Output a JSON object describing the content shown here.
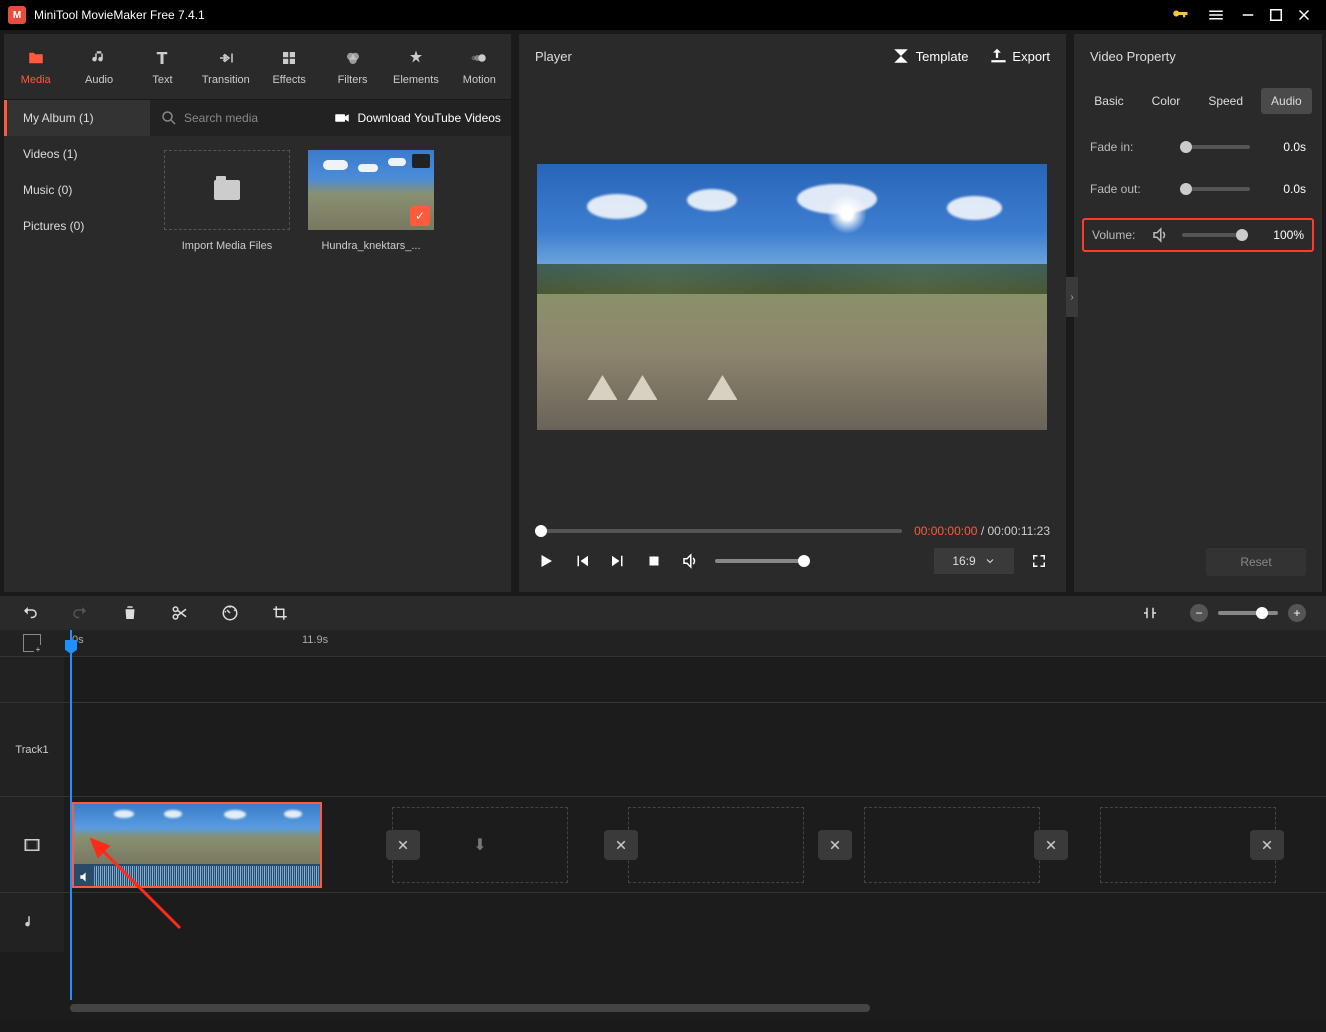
{
  "titlebar": {
    "app_name": "MiniTool MovieMaker Free 7.4.1"
  },
  "tabs": {
    "media": "Media",
    "audio": "Audio",
    "text": "Text",
    "transition": "Transition",
    "effects": "Effects",
    "filters": "Filters",
    "elements": "Elements",
    "motion": "Motion"
  },
  "album": {
    "my_album": "My Album (1)",
    "videos": "Videos (1)",
    "music": "Music (0)",
    "pictures": "Pictures (0)",
    "search_placeholder": "Search media",
    "download": "Download YouTube Videos",
    "import_label": "Import Media Files",
    "clip_label": "Hundra_knektars_..."
  },
  "player": {
    "title": "Player",
    "template": "Template",
    "export": "Export",
    "current_time": "00:00:00:00",
    "total_time": "00:00:11:23",
    "aspect": "16:9"
  },
  "property": {
    "title": "Video Property",
    "tabs": {
      "basic": "Basic",
      "color": "Color",
      "speed": "Speed",
      "audio": "Audio"
    },
    "fade_in": {
      "label": "Fade in:",
      "value": "0.0s"
    },
    "fade_out": {
      "label": "Fade out:",
      "value": "0.0s"
    },
    "volume": {
      "label": "Volume:",
      "value": "100%"
    },
    "reset": "Reset"
  },
  "timeline": {
    "mark0": "0s",
    "mark_end": "11.9s",
    "track1": "Track1"
  }
}
